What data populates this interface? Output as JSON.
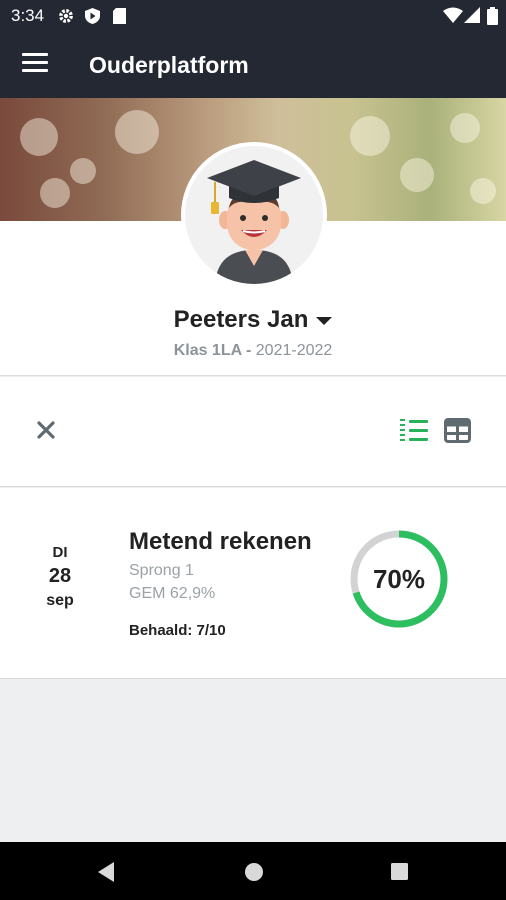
{
  "status_bar": {
    "time": "3:34",
    "left_icons": [
      "gear-icon",
      "shield-play-icon",
      "sd-card-icon"
    ],
    "right_icons": [
      "wifi-icon",
      "cell-signal-icon",
      "battery-icon"
    ]
  },
  "app_bar": {
    "title": "Ouderplatform"
  },
  "profile": {
    "name": "Peeters Jan",
    "class_label": "Klas 1LA",
    "separator": " - ",
    "school_year": "2021-2022"
  },
  "toolbar": {
    "left_icon": "close-icon",
    "right_icons": [
      "list-view-icon",
      "table-view-icon"
    ],
    "accent": "#27b15a"
  },
  "result_card": {
    "day_of_week": "DI",
    "day": "28",
    "month": "sep",
    "title": "Metend rekenen",
    "subtitle": "Sprong 1",
    "average": "GEM 62,9%",
    "score_label": "Behaald: 7/10",
    "percent_label": "70%",
    "progress": 0.7,
    "ring_color": "#2dbe60",
    "ring_track": "#d3d3d3"
  },
  "nav_bar": {
    "buttons": [
      "back-icon",
      "home-icon",
      "recents-icon"
    ]
  }
}
